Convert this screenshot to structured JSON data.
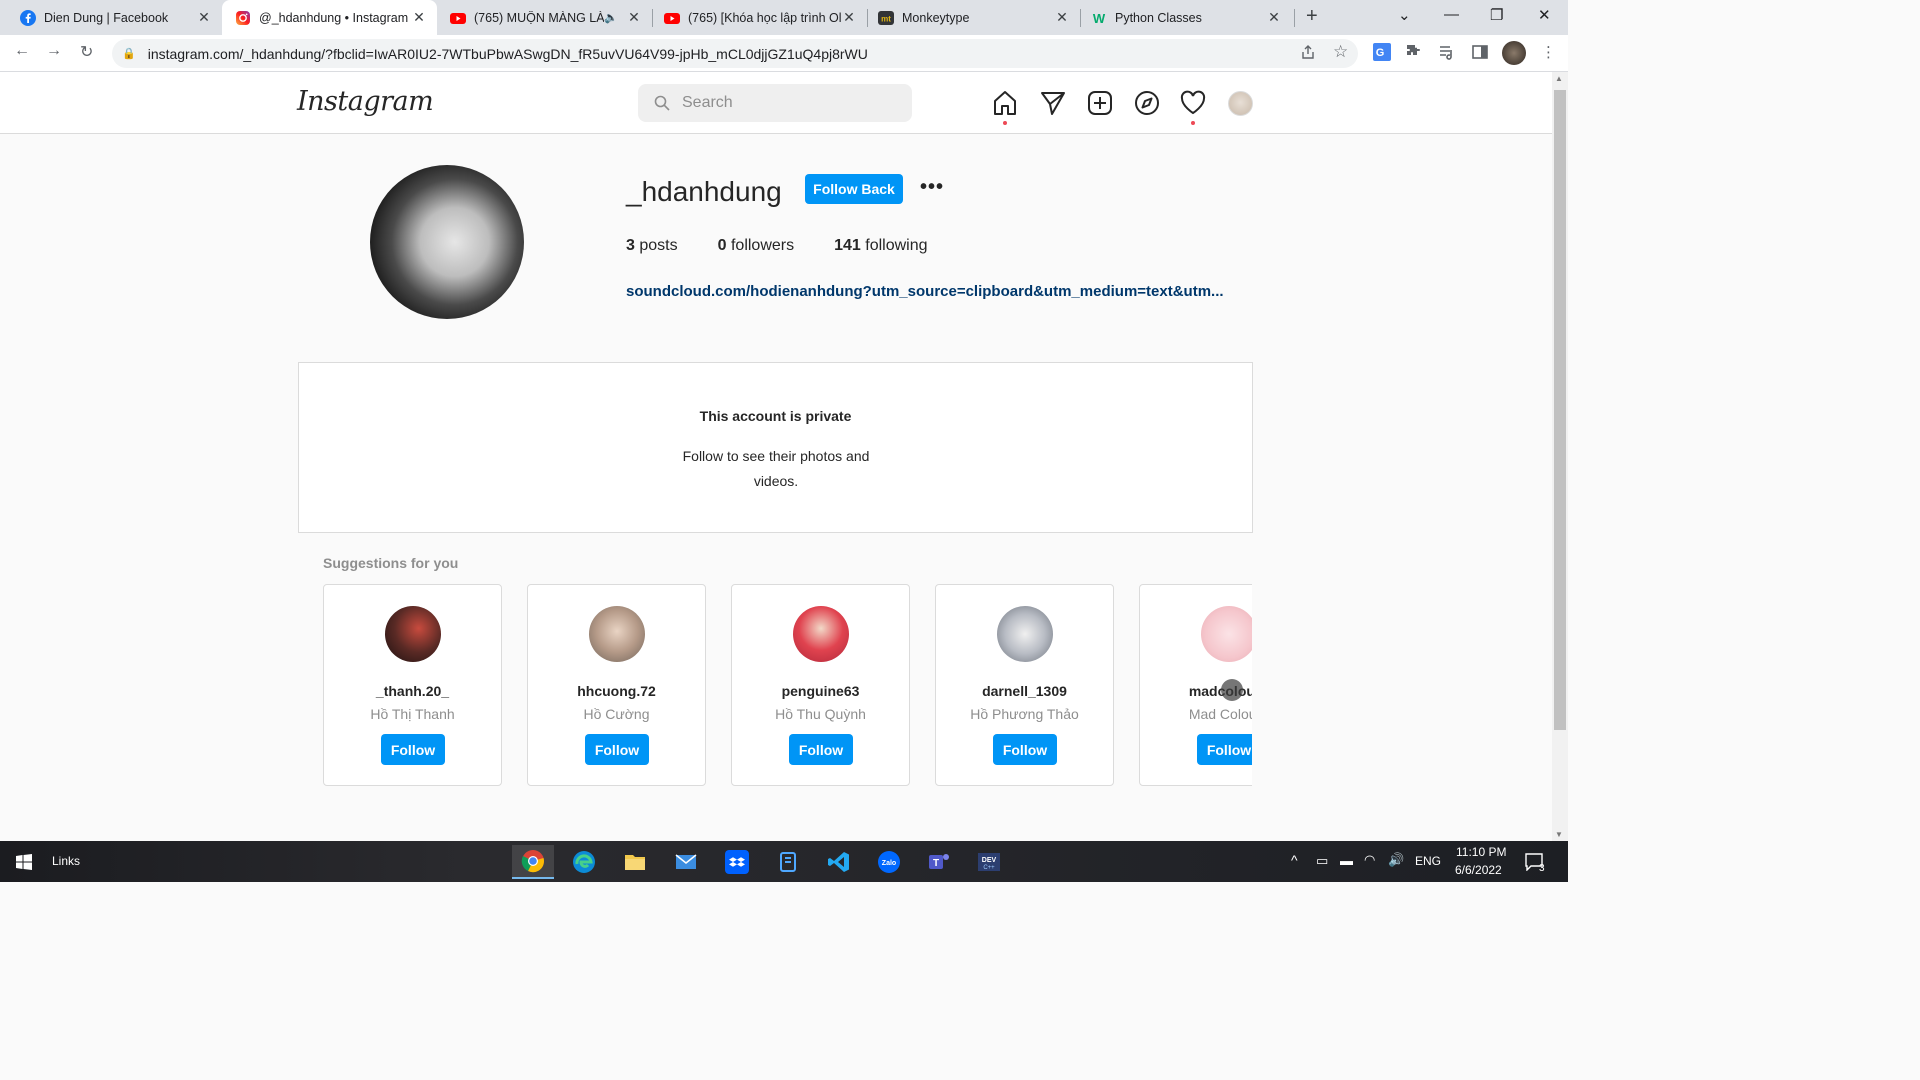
{
  "tabs": [
    {
      "title": "Dien Dung | Facebook",
      "icon": "facebook-icon"
    },
    {
      "title": "@_hdanhdung • Instagram",
      "icon": "instagram-icon",
      "active": true
    },
    {
      "title": "(765) MUỘN MÀNG LÀ",
      "icon": "youtube-icon",
      "muted": true
    },
    {
      "title": "(765) [Khóa học lập trình Ol",
      "icon": "youtube-icon"
    },
    {
      "title": "Monkeytype",
      "icon": "monkeytype-icon"
    },
    {
      "title": "Python Classes",
      "icon": "w3schools-icon"
    }
  ],
  "address_bar": {
    "host": "instagram.com",
    "path": "/_hdanhdung/?fbclid=IwAR0IU2-7WTbuPbwASwgDN_fR5uvVU64V99-jpHb_mCL0djjGZ1uQ4pj8rWU"
  },
  "instagram": {
    "logo": "Instagram",
    "search_placeholder": "Search",
    "profile": {
      "username": "_hdanhdung",
      "follow_back_label": "Follow Back",
      "more_label": "•••",
      "posts_count": "3",
      "posts_label": "posts",
      "followers_count": "0",
      "followers_label": "followers",
      "following_count": "141",
      "following_label": "following",
      "link": "soundcloud.com/hodienanhdung?utm_source=clipboard&utm_medium=text&utm..."
    },
    "private": {
      "heading": "This account is private",
      "message": "Follow to see their photos and videos."
    },
    "suggestions_title": "Suggestions for you",
    "suggestions": [
      {
        "username": "_thanh.20_",
        "name": "Hồ Thị Thanh",
        "button": "Follow",
        "avatar_color": "#5a2a25"
      },
      {
        "username": "hhcuong.72",
        "name": "Hồ Cường",
        "button": "Follow",
        "avatar_color": "#b59a88"
      },
      {
        "username": "penguine63",
        "name": "Hồ Thu Quỳnh",
        "button": "Follow",
        "avatar_color": "#e0434f"
      },
      {
        "username": "darnell_1309",
        "name": "Hồ Phương Thảo",
        "button": "Follow",
        "avatar_color": "#b8bcc4"
      },
      {
        "username": "madcolours",
        "name": "Mad Colours",
        "button": "Follow",
        "avatar_color": "#f5c6cc"
      }
    ]
  },
  "taskbar": {
    "links_label": "Links",
    "language": "ENG",
    "time": "11:10 PM",
    "date": "6/6/2022",
    "notification_count": "3"
  },
  "colors": {
    "ig_blue": "#0095f6",
    "link_blue": "#00376b",
    "tab_bar": "#dee1e6"
  }
}
